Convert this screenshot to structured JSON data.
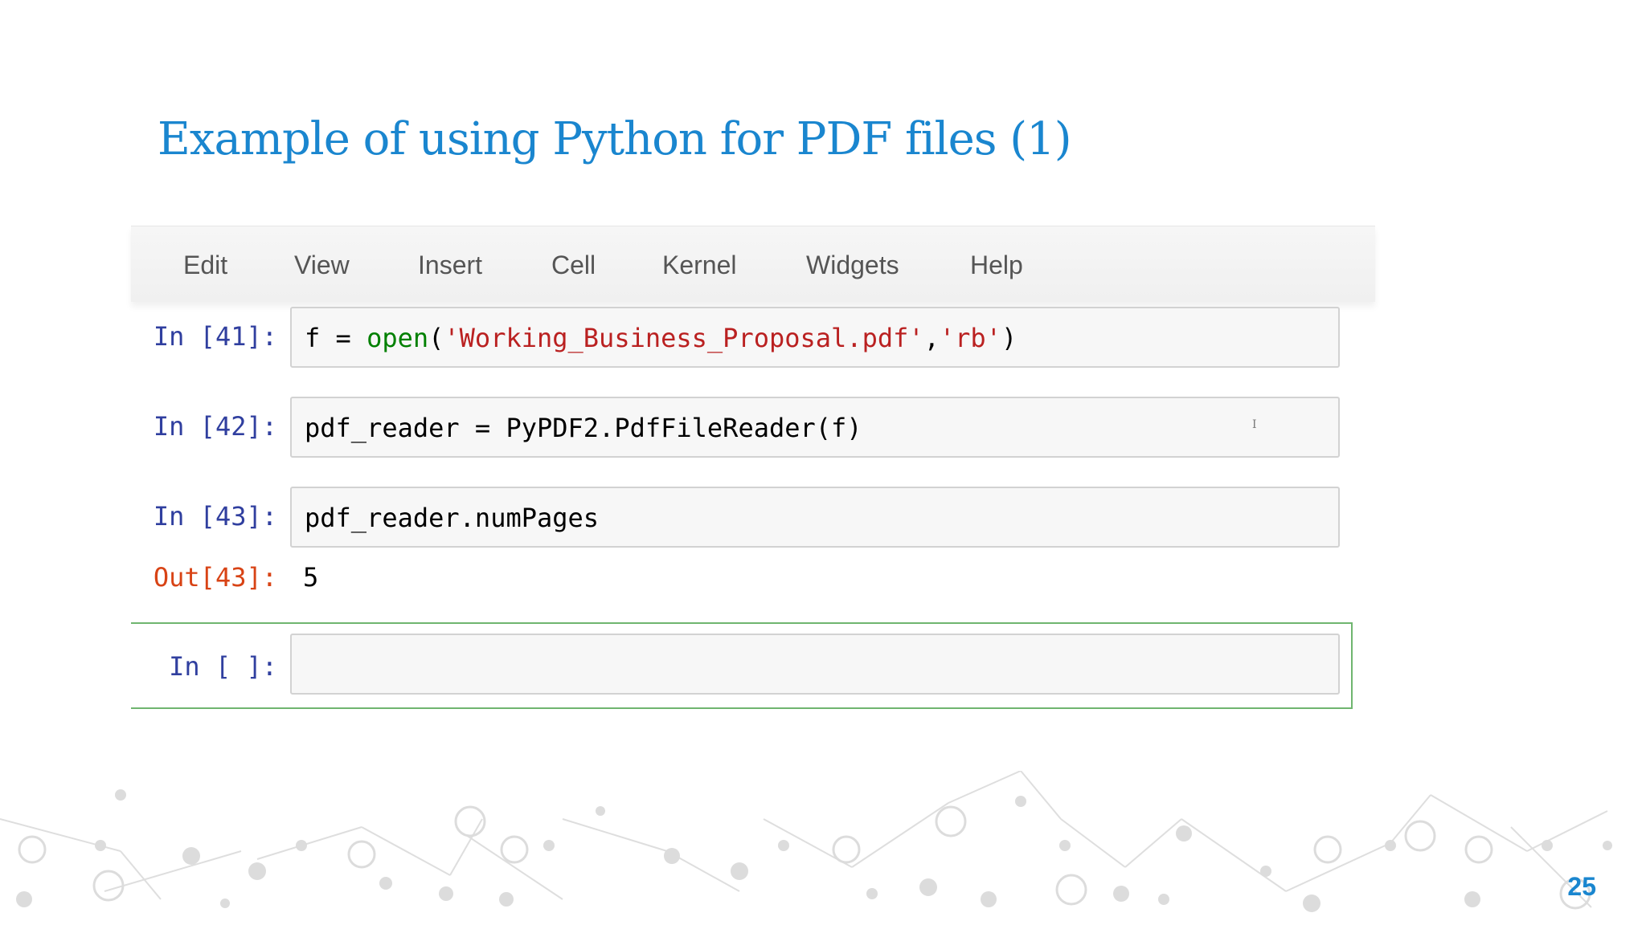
{
  "slide": {
    "title": "Example of using Python for PDF files (1)",
    "page_number": "25"
  },
  "menubar": {
    "items": [
      "Edit",
      "View",
      "Insert",
      "Cell",
      "Kernel",
      "Widgets",
      "Help"
    ]
  },
  "cells": [
    {
      "prompt": "In [41]:",
      "code_parts": {
        "var": "f = ",
        "func": "open",
        "p1": "(",
        "arg1": "'Working_Business_Proposal.pdf'",
        "comma": ",",
        "arg2": "'rb'",
        "p2": ")"
      }
    },
    {
      "prompt": "In [42]:",
      "code": "pdf_reader = PyPDF2.PdfFileReader(f)"
    },
    {
      "prompt": "In [43]:",
      "code": "pdf_reader.numPages",
      "out_prompt": "Out[43]:",
      "output": "5"
    },
    {
      "prompt": "In [ ]:",
      "code": ""
    }
  ],
  "colors": {
    "title": "#1a86cf",
    "prompt_in": "#303f9f",
    "prompt_out": "#d84315",
    "keyword_func": "#008000",
    "string": "#ba2121",
    "selected_border": "#6fb56f"
  }
}
